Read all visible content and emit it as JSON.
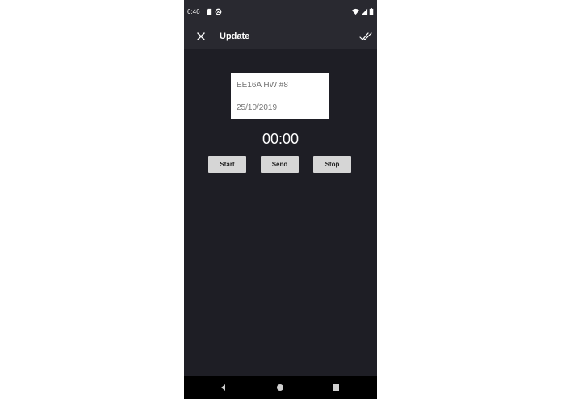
{
  "status_bar": {
    "time": "6:46",
    "icons": [
      "sd-card-icon",
      "sync-icon",
      "wifi-icon",
      "signal-icon",
      "battery-icon"
    ]
  },
  "app_bar": {
    "title": "Update",
    "close_icon": "close-icon",
    "done_icon": "double-check-icon"
  },
  "card": {
    "title": "EE16A HW #8",
    "date": "25/10/2019"
  },
  "timer": {
    "value": "00:00"
  },
  "buttons": {
    "start": "Start",
    "send": "Send",
    "stop": "Stop"
  },
  "nav": {
    "icons": [
      "back-icon",
      "home-icon",
      "recents-icon"
    ]
  },
  "colors": {
    "background": "#1e1e25",
    "bar": "#292930",
    "button": "#d6d6d6",
    "card": "#ffffff"
  }
}
